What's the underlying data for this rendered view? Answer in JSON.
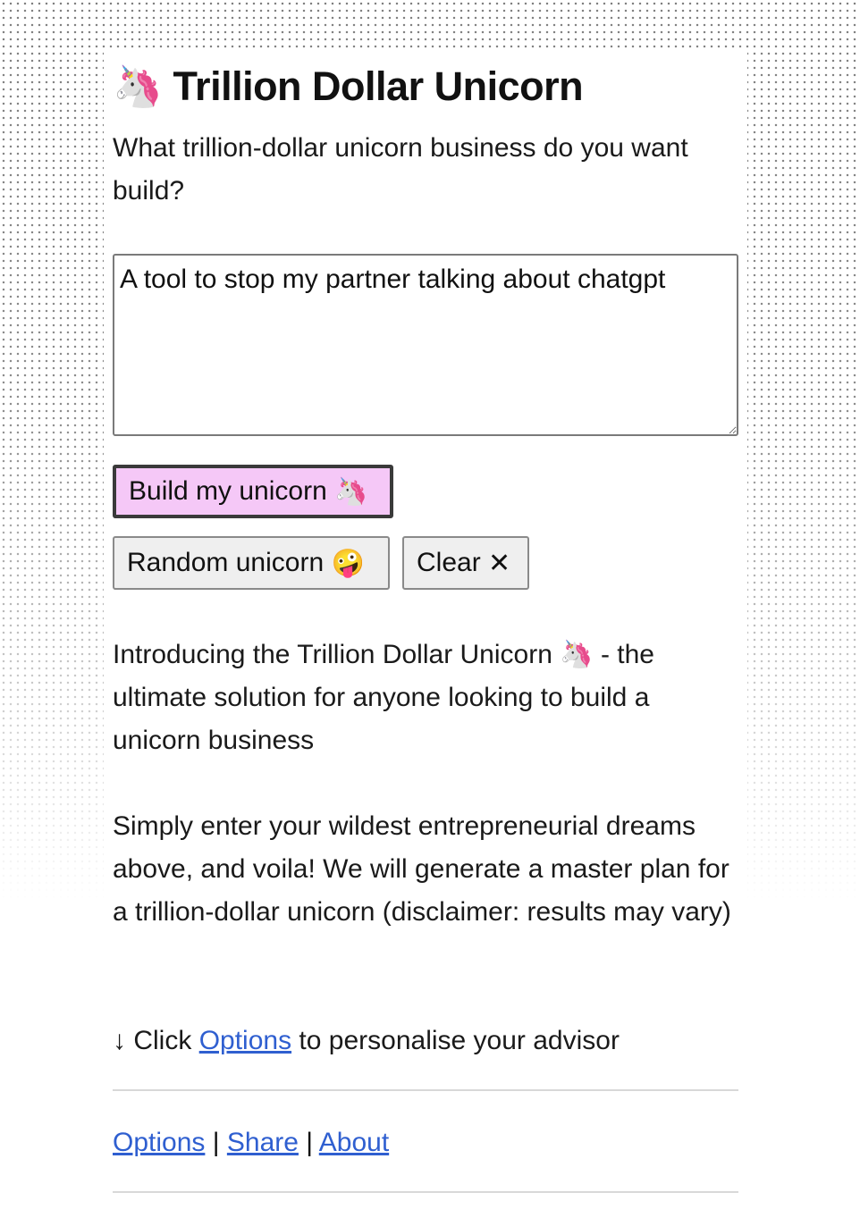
{
  "header": {
    "icon": "unicorn-icon",
    "title": "Trillion Dollar Unicorn"
  },
  "prompt": "What trillion-dollar unicorn business do you want build?",
  "idea_input": {
    "value": "A tool to stop my partner talking about chatgpt"
  },
  "buttons": {
    "build_label": "Build my unicorn",
    "build_icon": "unicorn-icon",
    "random_label": "Random unicorn",
    "random_icon": "zany-face-icon",
    "clear_label": "Clear",
    "clear_icon": "close-icon",
    "build_color": "#f5c8f7"
  },
  "intro": {
    "p1_before": "Introducing the Trillion Dollar Unicorn",
    "p1_icon": "unicorn-icon",
    "p1_after": "- the ultimate solution for anyone looking to build a unicorn business",
    "p2": "Simply enter your wildest entrepreneurial dreams above, and voila! We will generate a master plan for a trillion-dollar unicorn (disclaimer: results may vary)",
    "hint_arrow": "↓",
    "hint_before": "Click",
    "hint_link": "Options",
    "hint_after": "to personalise your advisor"
  },
  "footer": {
    "links": [
      "Options",
      "Share",
      "About"
    ],
    "separator": "|"
  },
  "colors": {
    "link": "#2f5fd0"
  }
}
